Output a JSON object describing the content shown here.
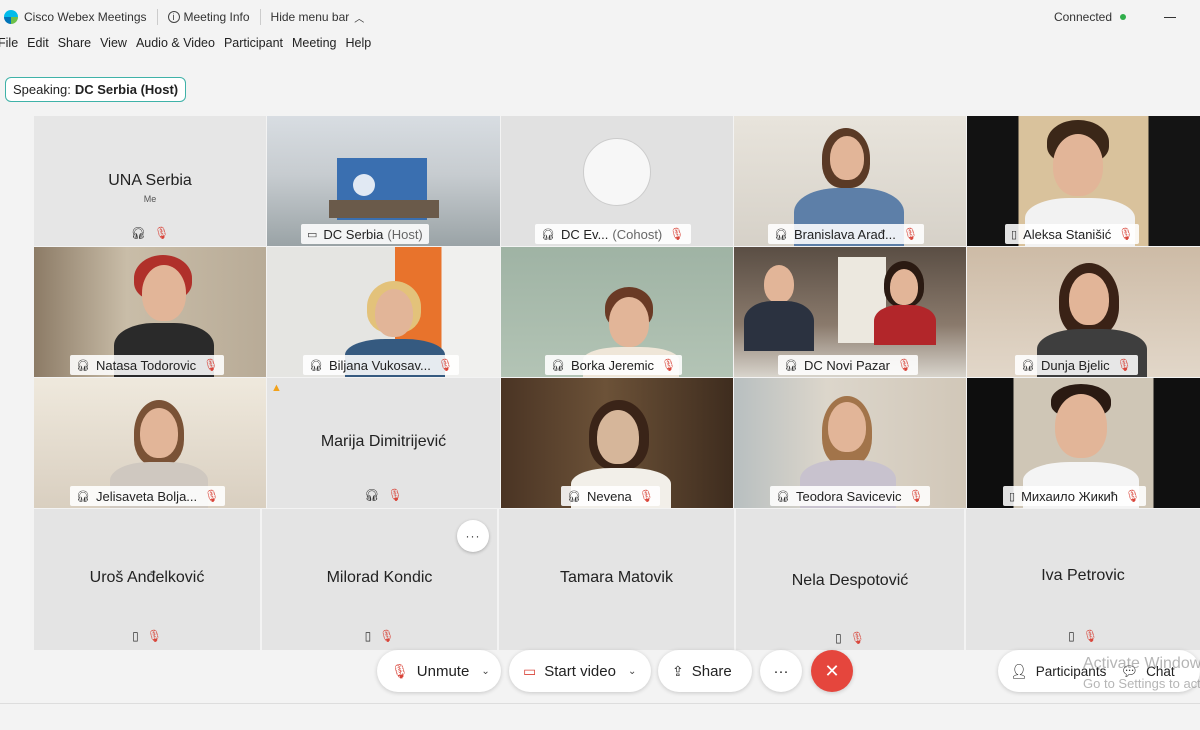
{
  "titlebar": {
    "app_name": "Cisco Webex Meetings",
    "meeting_info": "Meeting Info",
    "hide_menu": "Hide menu bar",
    "status": "Connected"
  },
  "menu": [
    "File",
    "Edit",
    "Share",
    "View",
    "Audio & Video",
    "Participant",
    "Meeting",
    "Help"
  ],
  "speaking": {
    "prefix": "Speaking:",
    "name": "DC Serbia (Host)"
  },
  "tiles": {
    "una_serbia": {
      "name": "UNA Serbia",
      "sub": "Me"
    },
    "dc_serbia": {
      "name": "DC Serbia",
      "role": "(Host)"
    },
    "dc_ev": {
      "name": "DC Ev...",
      "role": "(Cohost)"
    },
    "branislava": {
      "name": "Branislava Arađ..."
    },
    "aleksa": {
      "name": "Aleksa Stanišić"
    },
    "natasa": {
      "name": "Natasa Todorovic"
    },
    "biljana": {
      "name": "Biljana Vukosav..."
    },
    "borka": {
      "name": "Borka Jeremic"
    },
    "dc_novi_pazar": {
      "name": "DC Novi Pazar"
    },
    "dunja": {
      "name": "Dunja Bjelic"
    },
    "jelisaveta": {
      "name": "Jelisaveta Bolja..."
    },
    "marija": {
      "name": "Marija Dimitrijević"
    },
    "nevena": {
      "name": "Nevena"
    },
    "teodora": {
      "name": "Teodora Savicevic"
    },
    "mihailo": {
      "name": "Михаило Жикић"
    },
    "uros": {
      "name": "Uroš Anđelković"
    },
    "milorad": {
      "name": "Milorad Kondic"
    },
    "tamara": {
      "name": "Tamara Matovik"
    },
    "nela": {
      "name": "Nela Despotović"
    },
    "iva": {
      "name": "Iva Petrovic"
    }
  },
  "controls": {
    "unmute": "Unmute",
    "start_video": "Start video",
    "share": "Share",
    "more": "···",
    "end": "✕",
    "participants": "Participants",
    "chat": "Chat"
  },
  "watermark": {
    "line1": "Activate Windows",
    "line2": "Go to Settings to activate Windows."
  },
  "colors": {
    "accent": "#36b2d8",
    "end_red": "#e5463d",
    "mute_red": "#d9453a",
    "connected_green": "#2fae4a"
  }
}
